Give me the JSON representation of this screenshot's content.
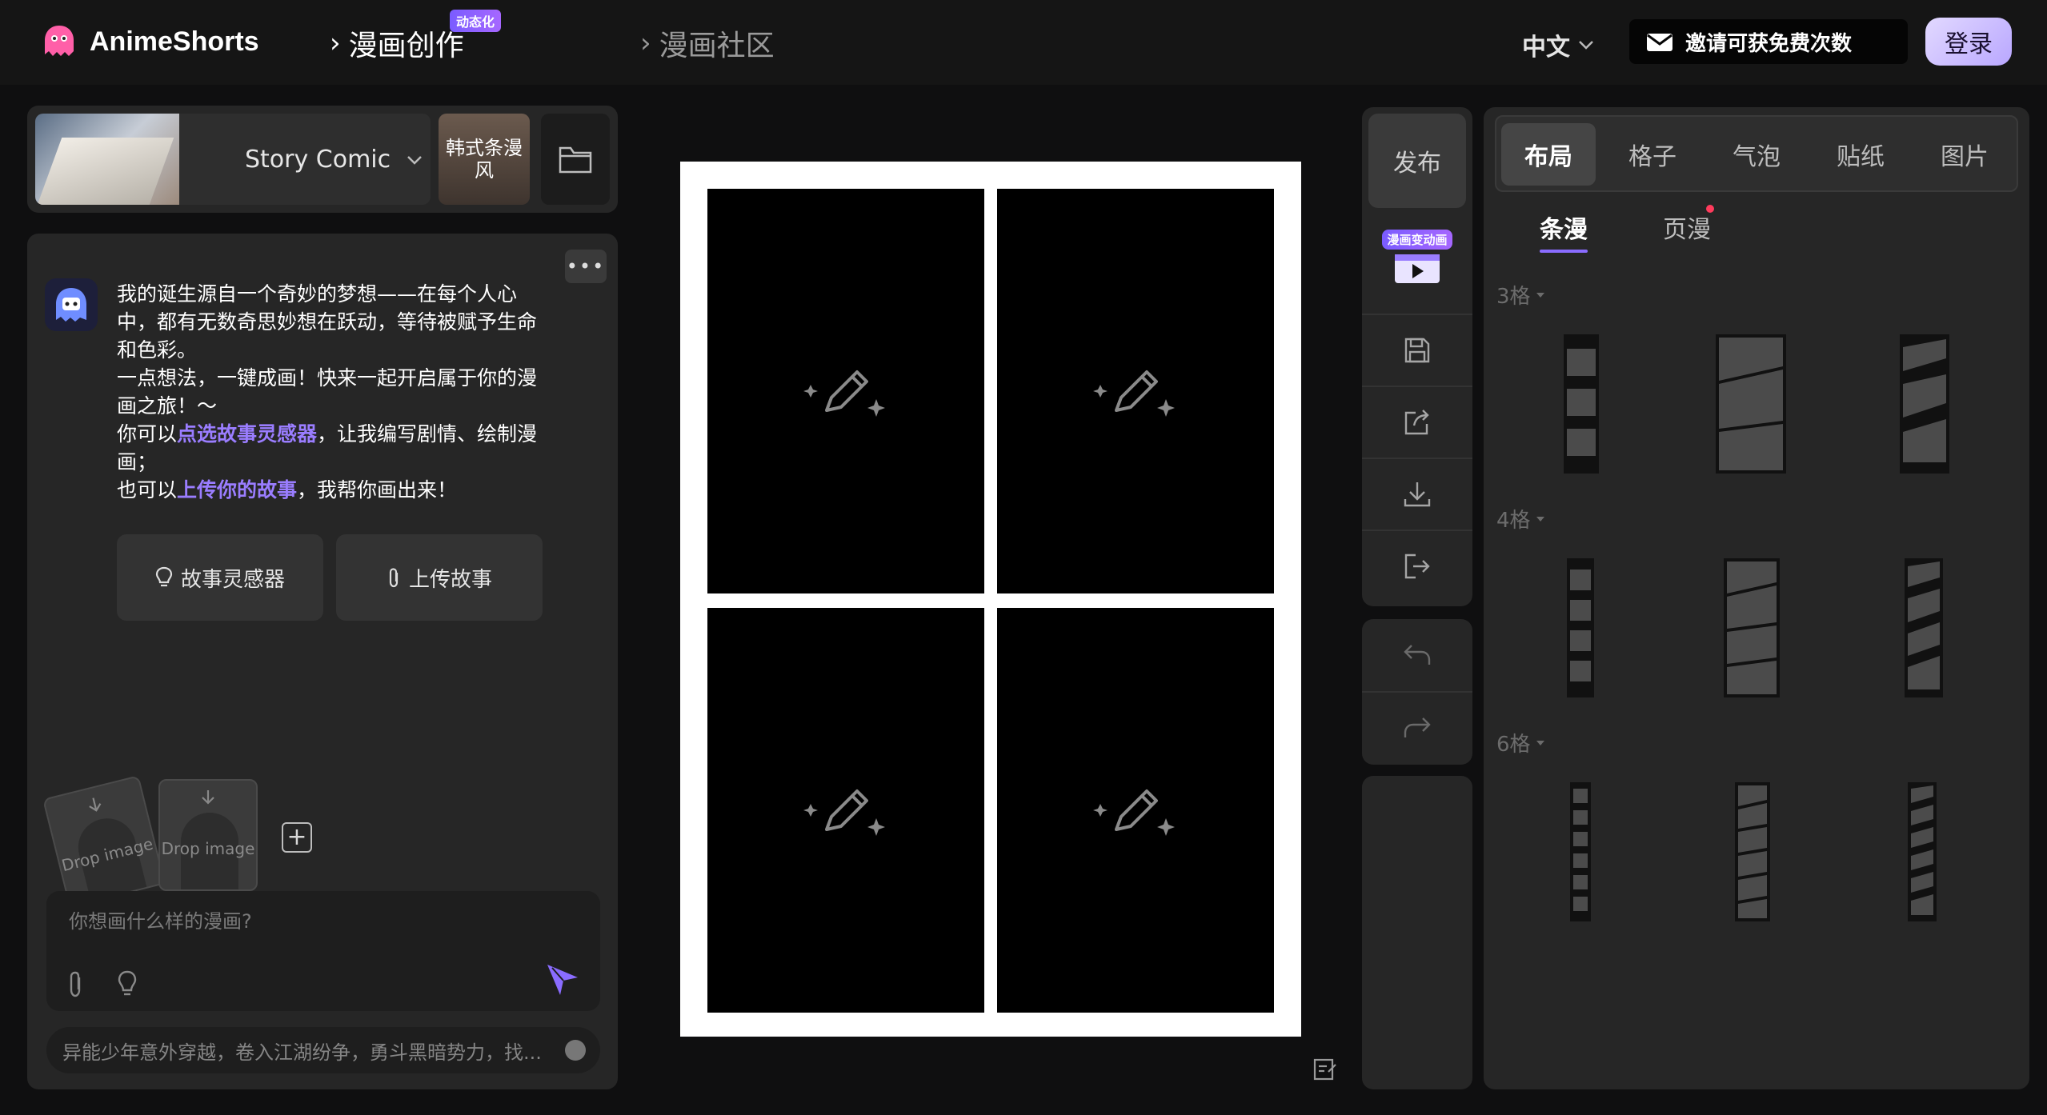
{
  "header": {
    "logo_text": "AnimeShorts",
    "nav_create": "漫画创作",
    "nav_create_badge": "动态化",
    "nav_community": "漫画社区",
    "language": "中文",
    "invite_text": "邀请可获免费次数",
    "login_label": "登录"
  },
  "style_bar": {
    "style_name": "Story Comic",
    "alt_style": "韩式条漫风"
  },
  "chat": {
    "message_lines": [
      "我的诞生源自一个奇妙的梦想——在每个人心",
      "中，都有无数奇思妙想在跃动，等待被赋予生命",
      "和色彩。",
      "一点想法，一键成画！快来一起开启属于你的漫",
      "画之旅！～"
    ],
    "line6_pre": "你可以",
    "line6_link": "点选故事灵感器",
    "line6_post": "，让我编写剧情、绘制漫",
    "line7": "画；",
    "line8_pre": "也可以",
    "line8_link": "上传你的故事",
    "line8_post": "，我帮你画出来！",
    "btn_inspiration": "故事灵感器",
    "btn_upload": "上传故事",
    "drop_label_1": "Drop image",
    "drop_label_2": "Drop image",
    "input_placeholder": "你想画什么样的漫画?",
    "suggestion": "异能少年意外穿越，卷入江湖纷争，勇斗黑暗势力，找..."
  },
  "tools": {
    "publish": "发布",
    "anim_badge": "漫画变动画"
  },
  "right_panel": {
    "tabs": [
      "布局",
      "格子",
      "气泡",
      "贴纸",
      "图片"
    ],
    "active_tab": "布局",
    "sub_tabs": [
      "条漫",
      "页漫"
    ],
    "sections": [
      "3格",
      "4格",
      "6格"
    ]
  },
  "colors": {
    "accent": "#8a6cff",
    "highlight_text": "#9a7dff",
    "background": "#0f0f10",
    "panel": "#262626"
  }
}
